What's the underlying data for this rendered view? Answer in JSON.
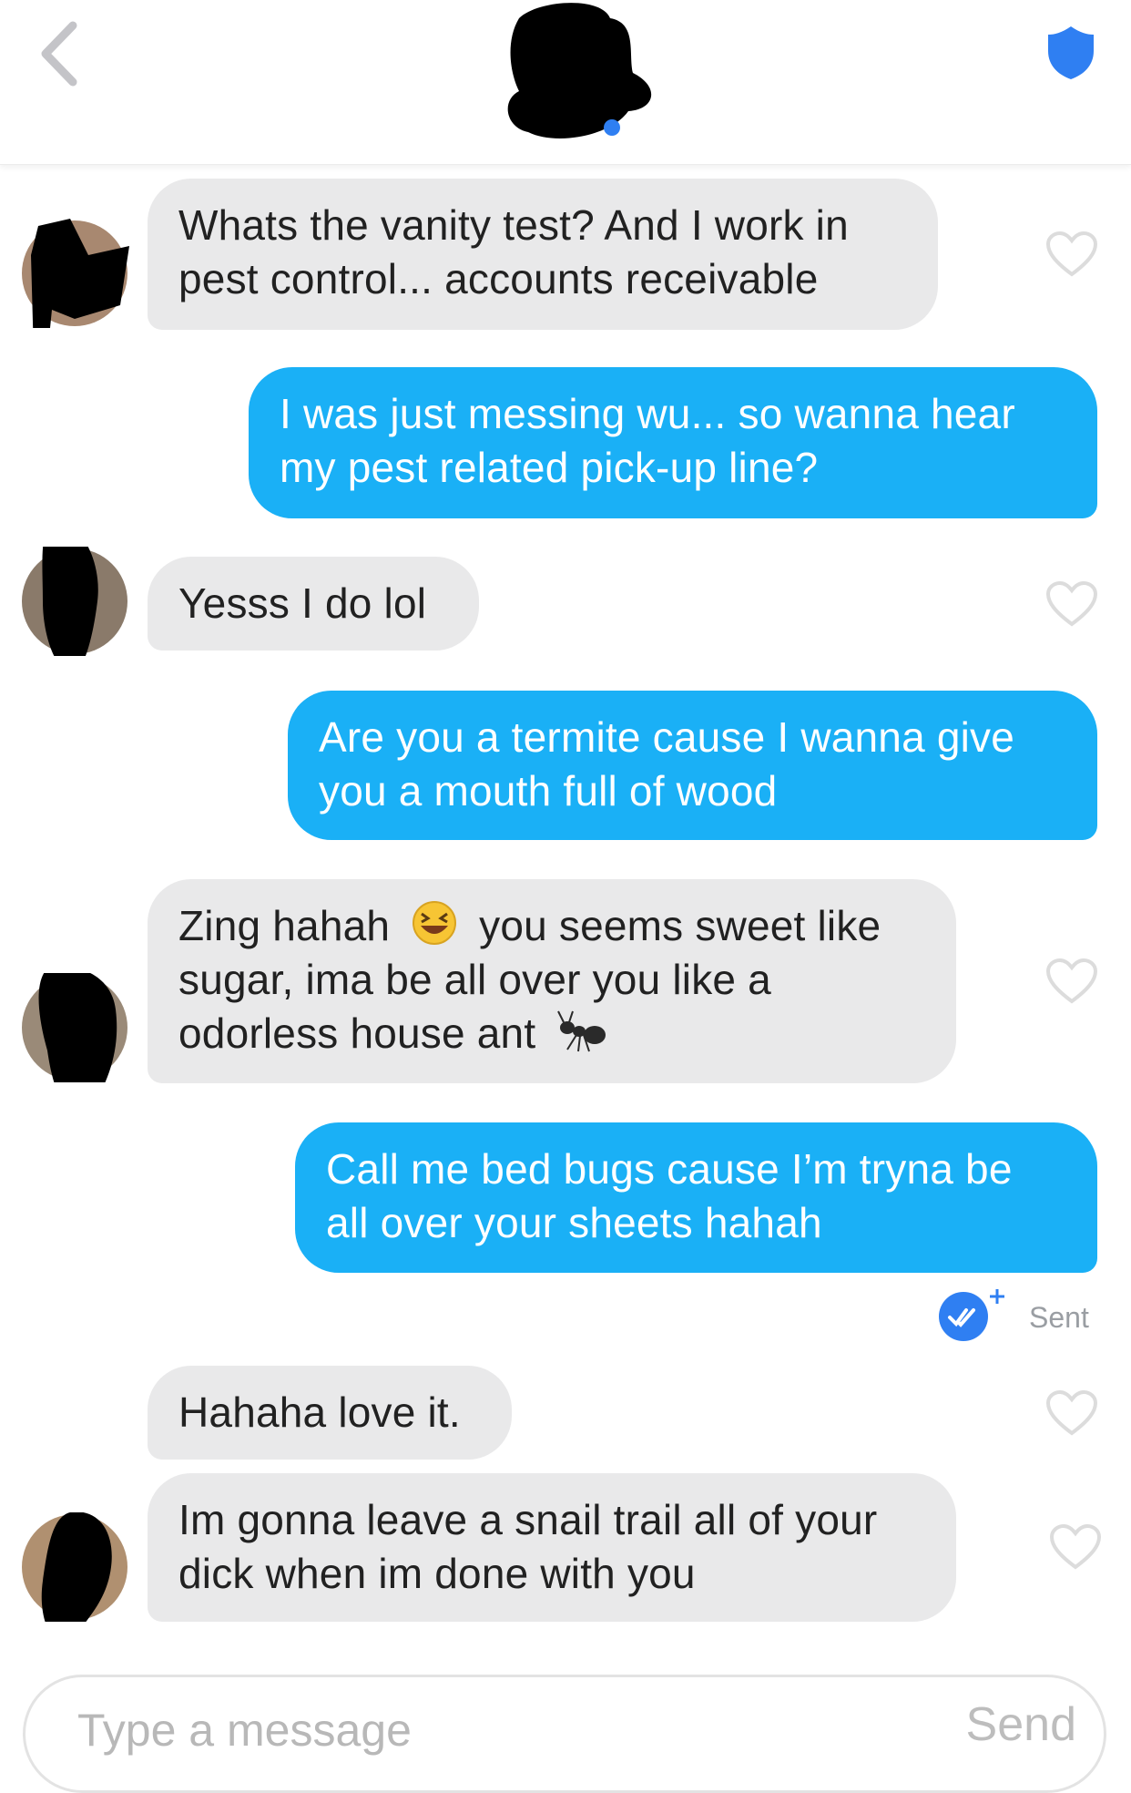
{
  "header": {
    "back_icon": "chevron-left-icon",
    "safety_icon": "shield-icon",
    "accent": "#2f7ff2"
  },
  "messages": [
    {
      "side": "in",
      "text": "Whats the vanity test? And I work in pest control... accounts receivable"
    },
    {
      "side": "out",
      "text": "I was just messing wu... so wanna hear my pest related pick-up line?"
    },
    {
      "side": "in",
      "text": "Yesss I do lol"
    },
    {
      "side": "out",
      "text": "Are you a termite cause I wanna give you a mouth full of wood"
    },
    {
      "side": "in",
      "text_before_emoji": "Zing hahah",
      "emoji_1": "laughing-face-emoji",
      "text_middle": "you seems sweet like sugar, ima be all over you like a odorless house ant",
      "emoji_2": "ant-emoji"
    },
    {
      "side": "out",
      "text": "Call me bed bugs cause I’m tryna be all over your sheets hahah"
    },
    {
      "side": "in",
      "text": "Hahaha love it."
    },
    {
      "side": "in",
      "text": "Im gonna leave a snail trail all of your dick when im done with you"
    }
  ],
  "receipt": {
    "status": "Sent",
    "icon": "double-check-icon"
  },
  "composer": {
    "placeholder": "Type a message",
    "send_label": "Send"
  },
  "colors": {
    "outgoing": "#1ab0f6",
    "incoming": "#e9e9ea",
    "heart_outline": "#dcdcdc"
  }
}
